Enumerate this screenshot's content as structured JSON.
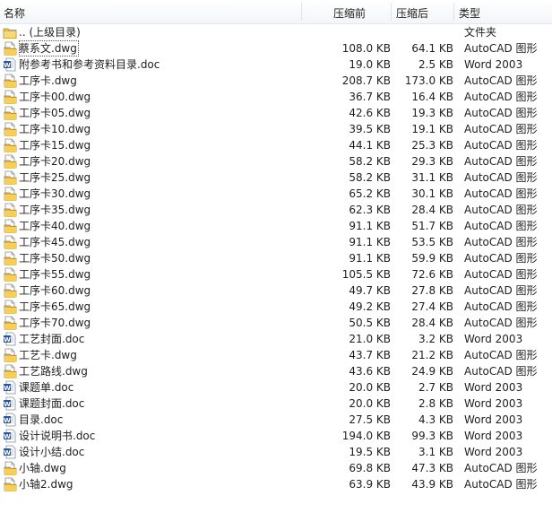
{
  "header": {
    "name": "名称",
    "before": "压缩前",
    "after": "压缩后",
    "type": "类型"
  },
  "rows": [
    {
      "icon": "folder-up-icon",
      "name": ".. (上级目录)",
      "before": "",
      "after": "",
      "type": "文件夹"
    },
    {
      "icon": "dwg-file-icon",
      "name": "蔡系文.dwg",
      "before": "108.0 KB",
      "after": "64.1 KB",
      "type": "AutoCAD 图形"
    },
    {
      "icon": "word-doc-icon",
      "name": "附参考书和参考资料目录.doc",
      "before": "19.0 KB",
      "after": "2.5 KB",
      "type": "Word 2003"
    },
    {
      "icon": "dwg-file-icon",
      "name": "工序卡.dwg",
      "before": "208.7 KB",
      "after": "173.0 KB",
      "type": "AutoCAD 图形"
    },
    {
      "icon": "dwg-file-icon",
      "name": "工序卡00.dwg",
      "before": "36.7 KB",
      "after": "16.4 KB",
      "type": "AutoCAD 图形"
    },
    {
      "icon": "dwg-file-icon",
      "name": "工序卡05.dwg",
      "before": "42.6 KB",
      "after": "19.3 KB",
      "type": "AutoCAD 图形"
    },
    {
      "icon": "dwg-file-icon",
      "name": "工序卡10.dwg",
      "before": "39.5 KB",
      "after": "19.1 KB",
      "type": "AutoCAD 图形"
    },
    {
      "icon": "dwg-file-icon",
      "name": "工序卡15.dwg",
      "before": "44.1 KB",
      "after": "25.3 KB",
      "type": "AutoCAD 图形"
    },
    {
      "icon": "dwg-file-icon",
      "name": "工序卡20.dwg",
      "before": "58.2 KB",
      "after": "29.3 KB",
      "type": "AutoCAD 图形"
    },
    {
      "icon": "dwg-file-icon",
      "name": "工序卡25.dwg",
      "before": "58.2 KB",
      "after": "31.1 KB",
      "type": "AutoCAD 图形"
    },
    {
      "icon": "dwg-file-icon",
      "name": "工序卡30.dwg",
      "before": "65.2 KB",
      "after": "30.1 KB",
      "type": "AutoCAD 图形"
    },
    {
      "icon": "dwg-file-icon",
      "name": "工序卡35.dwg",
      "before": "62.3 KB",
      "after": "28.4 KB",
      "type": "AutoCAD 图形"
    },
    {
      "icon": "dwg-file-icon",
      "name": "工序卡40.dwg",
      "before": "91.1 KB",
      "after": "51.7 KB",
      "type": "AutoCAD 图形"
    },
    {
      "icon": "dwg-file-icon",
      "name": "工序卡45.dwg",
      "before": "91.1 KB",
      "after": "53.5 KB",
      "type": "AutoCAD 图形"
    },
    {
      "icon": "dwg-file-icon",
      "name": "工序卡50.dwg",
      "before": "91.1 KB",
      "after": "59.9 KB",
      "type": "AutoCAD 图形"
    },
    {
      "icon": "dwg-file-icon",
      "name": "工序卡55.dwg",
      "before": "105.5 KB",
      "after": "72.6 KB",
      "type": "AutoCAD 图形"
    },
    {
      "icon": "dwg-file-icon",
      "name": "工序卡60.dwg",
      "before": "49.7 KB",
      "after": "27.8 KB",
      "type": "AutoCAD 图形"
    },
    {
      "icon": "dwg-file-icon",
      "name": "工序卡65.dwg",
      "before": "49.2 KB",
      "after": "27.4 KB",
      "type": "AutoCAD 图形"
    },
    {
      "icon": "dwg-file-icon",
      "name": "工序卡70.dwg",
      "before": "50.5 KB",
      "after": "28.4 KB",
      "type": "AutoCAD 图形"
    },
    {
      "icon": "word-doc-icon",
      "name": "工艺封面.doc",
      "before": "21.0 KB",
      "after": "3.2 KB",
      "type": "Word 2003"
    },
    {
      "icon": "dwg-file-icon",
      "name": "工艺卡.dwg",
      "before": "43.7 KB",
      "after": "21.2 KB",
      "type": "AutoCAD 图形"
    },
    {
      "icon": "dwg-file-icon",
      "name": "工艺路线.dwg",
      "before": "43.6 KB",
      "after": "24.9 KB",
      "type": "AutoCAD 图形"
    },
    {
      "icon": "word-doc-icon",
      "name": "课题单.doc",
      "before": "20.0 KB",
      "after": "2.7 KB",
      "type": "Word 2003"
    },
    {
      "icon": "word-doc-icon",
      "name": "课题封面.doc",
      "before": "20.0 KB",
      "after": "2.8 KB",
      "type": "Word 2003"
    },
    {
      "icon": "word-doc-icon",
      "name": "目录.doc",
      "before": "27.5 KB",
      "after": "4.3 KB",
      "type": "Word 2003"
    },
    {
      "icon": "word-doc-icon",
      "name": "设计说明书.doc",
      "before": "194.0 KB",
      "after": "99.3 KB",
      "type": "Word 2003"
    },
    {
      "icon": "word-doc-icon",
      "name": "设计小结.doc",
      "before": "19.5 KB",
      "after": "3.1 KB",
      "type": "Word 2003"
    },
    {
      "icon": "dwg-file-icon",
      "name": "小轴.dwg",
      "before": "69.8 KB",
      "after": "47.3 KB",
      "type": "AutoCAD 图形"
    },
    {
      "icon": "dwg-file-icon",
      "name": "小轴2.dwg",
      "before": "63.9 KB",
      "after": "43.9 KB",
      "type": "AutoCAD 图形"
    }
  ],
  "colors": {
    "folder": "#f3c24b",
    "dwg": "#e8b330",
    "word": "#2b5797"
  }
}
